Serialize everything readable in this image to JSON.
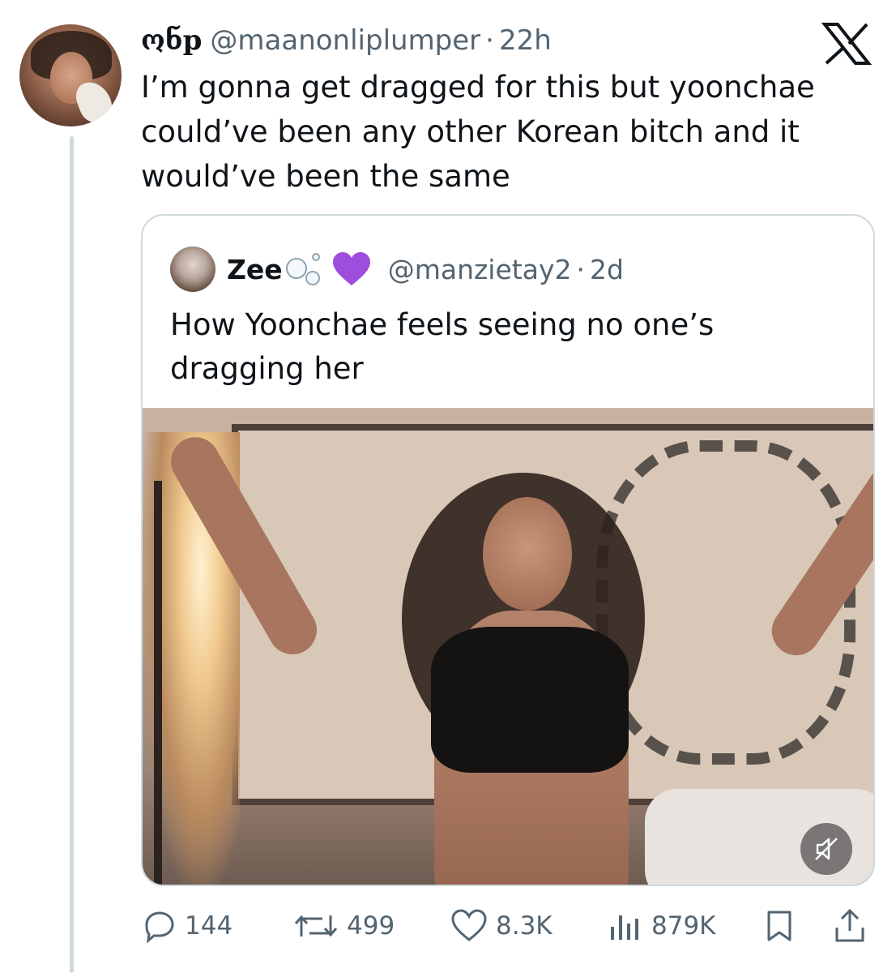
{
  "tweet": {
    "display_name": "ონp",
    "handle": "@maanonliplumper",
    "separator": "·",
    "time": "22h",
    "text": "I’m gonna get dragged for this but yoonchae could’ve been any other Korean bitch and it would’ve been the same"
  },
  "quoted_tweet": {
    "display_name": "Zee",
    "name_emojis": [
      "bubbles",
      "purple-heart"
    ],
    "handle": "@manzietay2",
    "separator": "·",
    "time": "2d",
    "text": "How Yoonchae feels seeing no one’s dragging her"
  },
  "actions": {
    "replies": "144",
    "reposts": "499",
    "likes": "8.3K",
    "views": "879K"
  },
  "colors": {
    "text_primary": "#0f1419",
    "text_secondary": "#536471",
    "border": "#cfd9de",
    "thread_line": "#cfd9de"
  },
  "icons": [
    "x-logo-icon",
    "mute-icon",
    "reply-icon",
    "repost-icon",
    "like-icon",
    "views-icon",
    "bookmark-icon",
    "share-icon"
  ]
}
